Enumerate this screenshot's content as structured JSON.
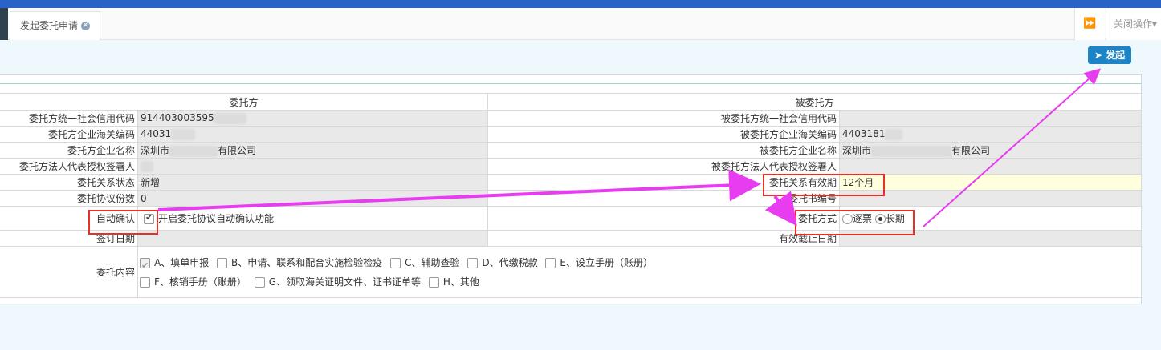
{
  "tabs": {
    "active_label": "发起委托申请",
    "close_ops_label": "关闭操作"
  },
  "toolbar": {
    "submit_label": "发起"
  },
  "table": {
    "left_header": "委托方",
    "right_header": "被委托方",
    "rows": [
      {
        "left_label": "委托方统一社会信用代码",
        "left_value": "914403003595",
        "right_label": "被委托方统一社会信用代码",
        "right_value": ""
      },
      {
        "left_label": "委托方企业海关编码",
        "left_value": "44031",
        "right_label": "被委托方企业海关编码",
        "right_value": "4403181"
      },
      {
        "left_label": "委托方企业名称",
        "left_value_prefix": "深圳市",
        "left_value_suffix": "有限公司",
        "right_label": "被委托方企业名称",
        "right_value_prefix": "深圳市",
        "right_value_suffix": "有限公司"
      },
      {
        "left_label": "委托方法人代表授权签署人",
        "left_value": "",
        "right_label": "被委托方法人代表授权签署人",
        "right_value": ""
      },
      {
        "left_label": "委托关系状态",
        "left_value": "新增",
        "right_label": "委托关系有效期",
        "right_value": "12个月"
      },
      {
        "left_label": "委托协议份数",
        "left_value": "0",
        "right_label": "委托书编号",
        "right_value": ""
      },
      {
        "left_label": "自动确认",
        "left_value": "开启委托协议自动确认功能",
        "right_label": "委托方式",
        "right_options": [
          "逐票",
          "长期"
        ],
        "right_selected": "长期"
      },
      {
        "left_label": "签订日期",
        "left_value": "",
        "right_label": "有效截止日期",
        "right_value": ""
      }
    ],
    "content_label": "委托内容",
    "content_line1": [
      "A、填单申报",
      "B、申请、联系和配合实施检验检疫",
      "C、辅助查验",
      "D、代缴税款",
      "E、设立手册（账册）"
    ],
    "content_line2": [
      "F、核销手册（账册）",
      "G、领取海关证明文件、证书证单等",
      "H、其他"
    ],
    "content_checked": [
      "A、填单申报"
    ]
  },
  "colors": {
    "accent": "#1c84c6",
    "annotation_arrow": "#e83cf0",
    "annotation_box": "#e8302b",
    "highlight": "#ffffde"
  }
}
